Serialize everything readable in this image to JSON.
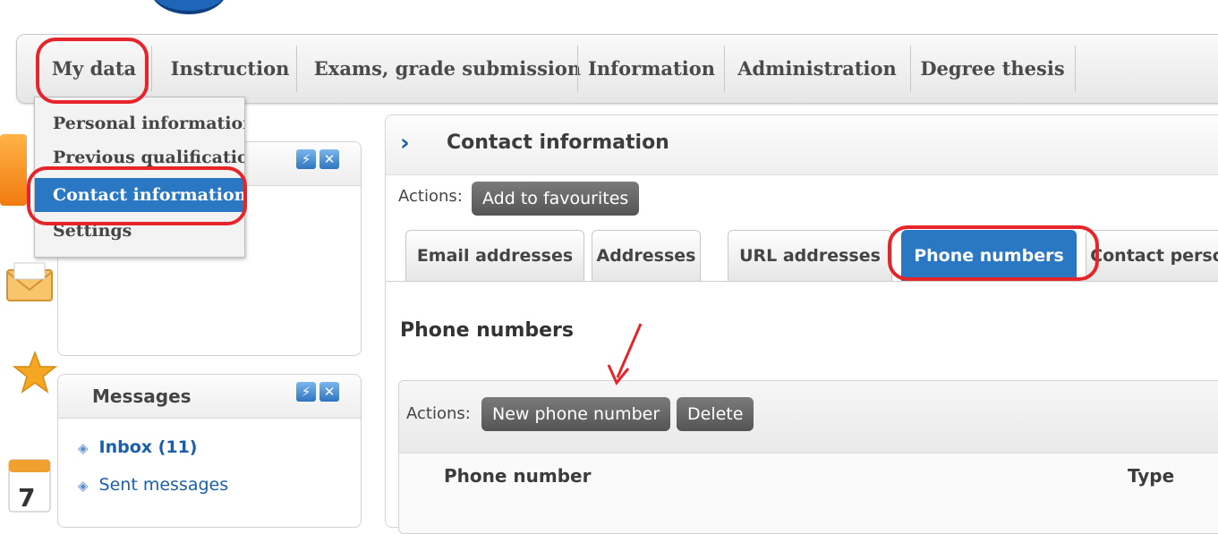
{
  "nav": {
    "items": [
      "My data",
      "Instruction",
      "Exams, grade submission",
      "Information",
      "Administration",
      "Degree thesis"
    ]
  },
  "dropdown": {
    "items": [
      "Personal information",
      "Previous qualifications",
      "Contact information",
      "Settings"
    ],
    "active": "Contact information"
  },
  "left_panels": {
    "messages": {
      "title": "Messages",
      "links": [
        "Inbox (11)",
        "Sent messages"
      ]
    },
    "refresh_icon_glyph": "⚡",
    "close_icon_glyph": "✕"
  },
  "content": {
    "title": "Contact information",
    "actions_label": "Actions:",
    "add_favourites": "Add to favourites",
    "tabs": [
      "Email addresses",
      "Addresses",
      "URL addresses",
      "Phone numbers",
      "Contact perso"
    ],
    "active_tab": "Phone numbers",
    "section_title": "Phone numbers",
    "grid": {
      "actions_label": "Actions:",
      "buttons": [
        "New phone number",
        "Delete"
      ],
      "columns": [
        "Phone number",
        "Type"
      ]
    }
  },
  "colors": {
    "accent_blue": "#2a78c4",
    "highlight_red": "#e6252b",
    "button_gray": "#666666"
  },
  "icons": [
    "refresh-icon",
    "close-icon",
    "chevron-right-icon",
    "diamond-bullet-icon",
    "envelope-icon",
    "star-icon",
    "calendar-icon",
    "arrow-annotation"
  ]
}
